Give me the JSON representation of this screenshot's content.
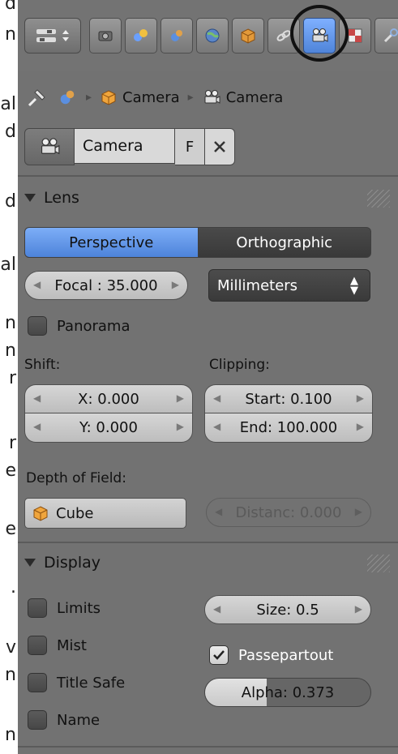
{
  "left_text_fragments": [
    "d",
    "n",
    "al",
    "d",
    "d",
    "al",
    "n",
    "n",
    "r",
    "r",
    "e",
    "e",
    ".",
    "v",
    "n",
    "n"
  ],
  "breadcrumb": {
    "object": "Camera",
    "data": "Camera"
  },
  "datablock": {
    "name": "Camera",
    "fake_user": "F"
  },
  "lens": {
    "title": "Lens",
    "projection": {
      "perspective": "Perspective",
      "orthographic": "Orthographic",
      "selected": "Perspective"
    },
    "focal": "Focal : 35.000",
    "unit": "Millimeters",
    "panorama": "Panorama",
    "shift_label": "Shift:",
    "shift_x": "X: 0.000",
    "shift_y": "Y: 0.000",
    "clipping_label": "Clipping:",
    "clip_start": "Start: 0.100",
    "clip_end": "End: 100.000",
    "dof_label": "Depth of Field:",
    "dof_object": "Cube",
    "dof_distance": "Distanc: 0.000"
  },
  "display": {
    "title": "Display",
    "limits": "Limits",
    "mist": "Mist",
    "title_safe": "Title Safe",
    "name": "Name",
    "size": "Size: 0.5",
    "passepartout": "Passepartout",
    "passepartout_checked": true,
    "alpha": "Alpha: 0.373",
    "alpha_value": 0.373
  },
  "colors": {
    "accent_blue": "#5b8fe0",
    "panel_bg": "#727272"
  }
}
